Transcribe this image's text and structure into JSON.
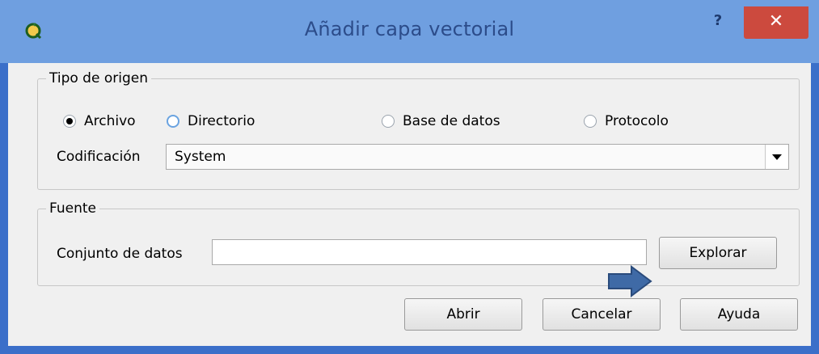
{
  "window": {
    "title": "Añadir capa vectorial",
    "help_label": "?",
    "close_label": "✕",
    "icon": "qgis-logo-icon"
  },
  "source_type": {
    "group_title": "Tipo de origen",
    "options": [
      {
        "label": "Archivo",
        "checked": true
      },
      {
        "label": "Directorio",
        "checked": false
      },
      {
        "label": "Base de datos",
        "checked": false
      },
      {
        "label": "Protocolo",
        "checked": false
      }
    ],
    "encoding_label": "Codificación",
    "encoding_value": "System"
  },
  "source": {
    "group_title": "Fuente",
    "dataset_label": "Conjunto de datos",
    "dataset_value": "",
    "browse_label": "Explorar"
  },
  "buttons": {
    "open_label": "Abrir",
    "cancel_label": "Cancelar",
    "help_label": "Ayuda"
  },
  "annotation": {
    "icon": "right-arrow-icon",
    "color": "#3f6aa6"
  },
  "colors": {
    "titlebar": "#6f9fe0",
    "close_button": "#cc4a3e",
    "window_border": "#3b6fc9"
  }
}
